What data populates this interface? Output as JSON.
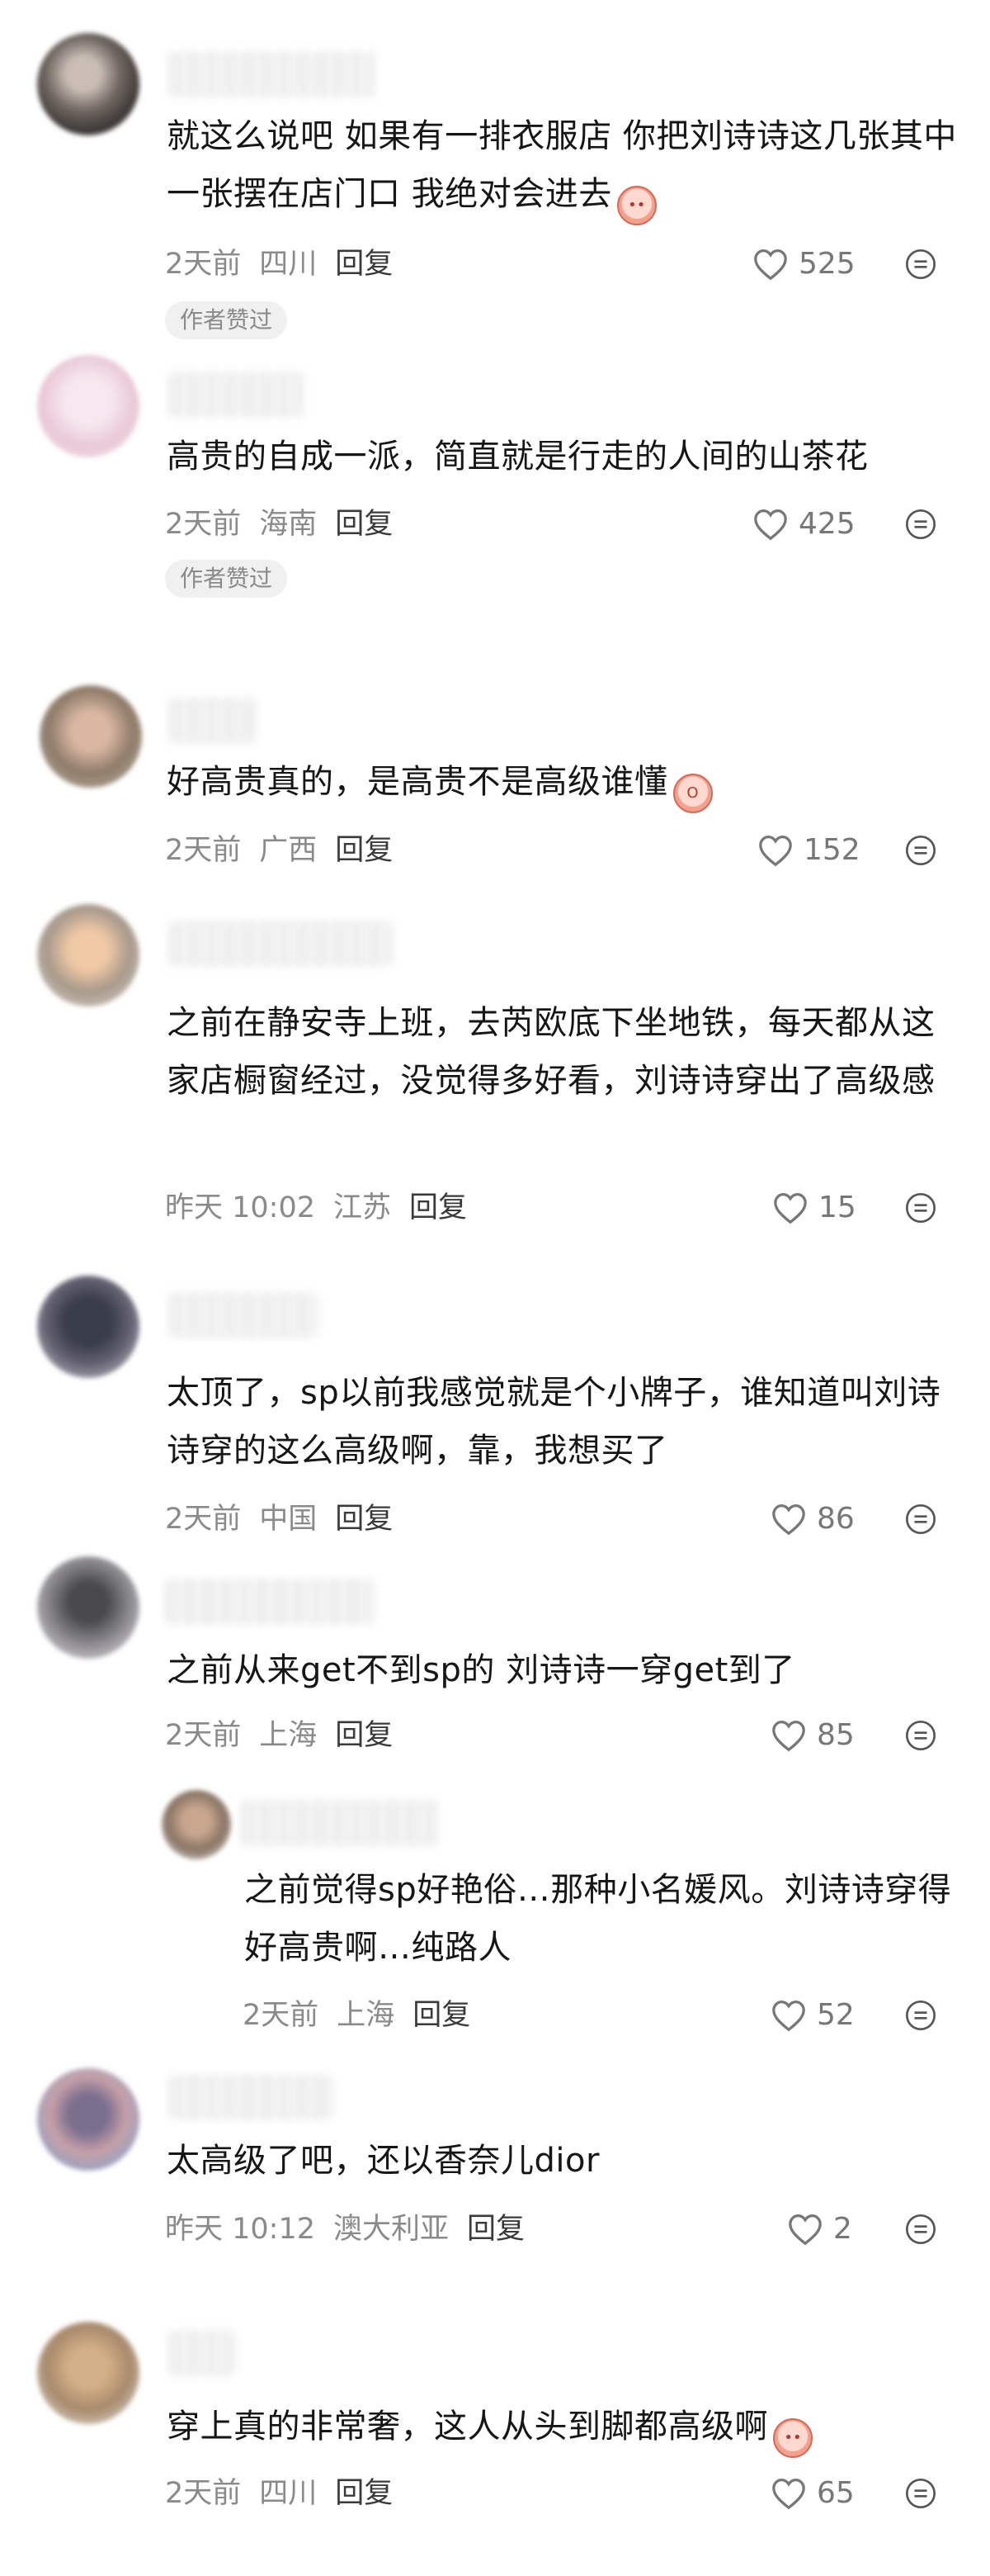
{
  "comments": [
    {
      "text": "就这么说吧  如果有一排衣服店  你把刘诗诗这几张其中一张摆在店门口  我绝对会进去",
      "emoji_icon": "crying-face-emoji",
      "time": "2天前",
      "location": "四川",
      "reply_label": "回复",
      "likes": "525",
      "badge": "作者赞过"
    },
    {
      "text": "高贵的自成一派，简直就是行走的人间的山茶花",
      "time": "2天前",
      "location": "海南",
      "reply_label": "回复",
      "likes": "425",
      "badge": "作者赞过"
    },
    {
      "text": "好高贵真的，是高贵不是高级谁懂",
      "emoji_icon": "screaming-face-emoji",
      "time": "2天前",
      "location": "广西",
      "reply_label": "回复",
      "likes": "152"
    },
    {
      "text": "之前在静安寺上班，去芮欧底下坐地铁，每天都从这家店橱窗经过，没觉得多好看，刘诗诗穿出了高级感",
      "time": "昨天 10:02",
      "location": "江苏",
      "reply_label": "回复",
      "likes": "15"
    },
    {
      "text": "太顶了，sp以前我感觉就是个小牌子，谁知道叫刘诗诗穿的这么高级啊，靠，我想买了",
      "time": "2天前",
      "location": "中国",
      "reply_label": "回复",
      "likes": "86"
    },
    {
      "text": "之前从来get不到sp的  刘诗诗一穿get到了",
      "time": "2天前",
      "location": "上海",
      "reply_label": "回复",
      "likes": "85"
    },
    {
      "text": "之前觉得sp好艳俗…那种小名媛风。刘诗诗穿得好高贵啊…纯路人",
      "time": "2天前",
      "location": "上海",
      "reply_label": "回复",
      "likes": "52"
    },
    {
      "text": "太高级了吧，还以香奈儿dior",
      "time": "昨天 10:12",
      "location": "澳大利亚",
      "reply_label": "回复",
      "likes": "2"
    },
    {
      "text": "穿上真的非常奢，这人从头到脚都高级啊",
      "emoji_icon": "pleading-face-emoji",
      "time": "2天前",
      "location": "四川",
      "reply_label": "回复",
      "likes": "65"
    }
  ],
  "icons": {
    "like": "heart-outline-icon",
    "more": "more-options-icon"
  },
  "colors": {
    "text": "#161616",
    "meta": "#8a8a8a",
    "badge_bg": "#f0f0f0"
  }
}
